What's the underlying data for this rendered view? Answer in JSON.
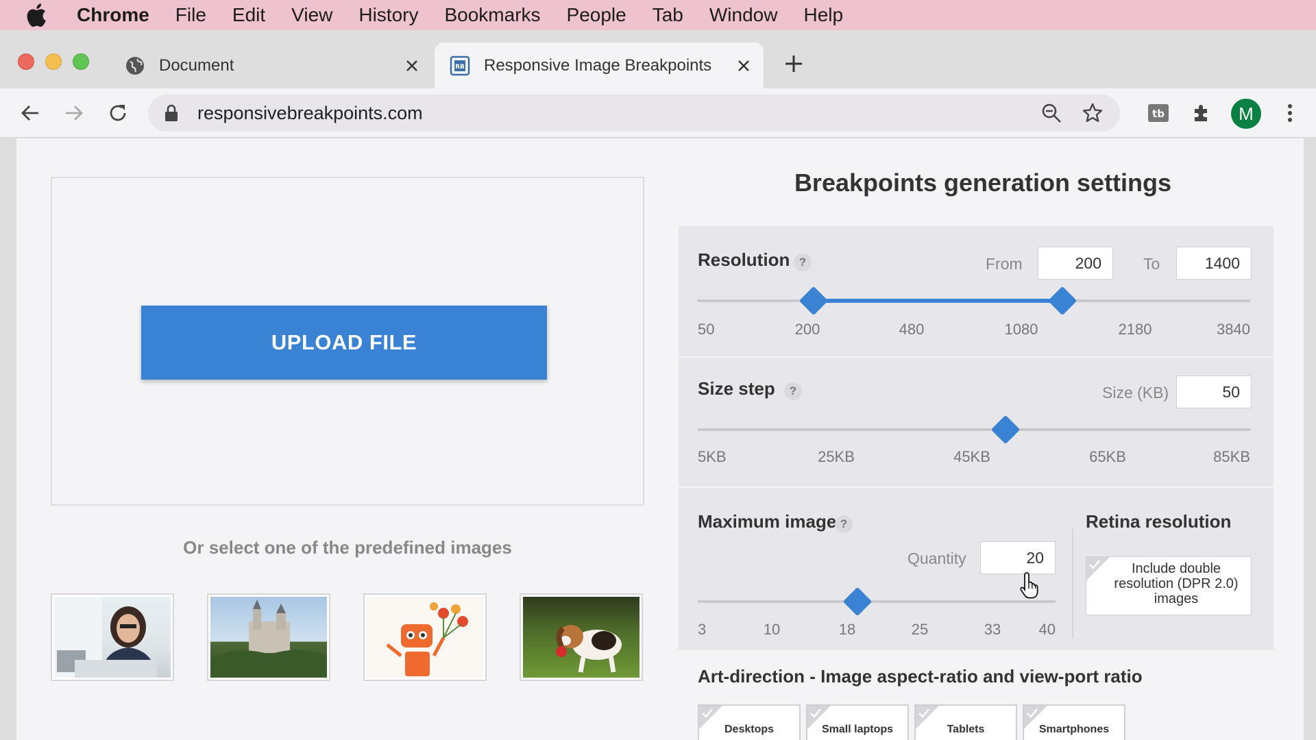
{
  "menubar": {
    "app": "Chrome",
    "items": [
      "File",
      "Edit",
      "View",
      "History",
      "Bookmarks",
      "People",
      "Tab",
      "Window",
      "Help"
    ]
  },
  "tabs": [
    {
      "title": "Document",
      "icon": "globe-icon"
    },
    {
      "title": "Responsive Image Breakpoints",
      "icon": "rb-favicon-icon"
    }
  ],
  "toolbar": {
    "url": "responsivebreakpoints.com",
    "avatar_initial": "M"
  },
  "upload": {
    "button_label": "UPLOAD FILE",
    "predefined_label": "Or select one of the predefined images"
  },
  "settings": {
    "title": "Breakpoints generation settings",
    "resolution": {
      "title": "Resolution",
      "help": "?",
      "from_label": "From",
      "from_value": "200",
      "to_label": "To",
      "to_value": "1400",
      "ticks": [
        "50",
        "200",
        "480",
        "1080",
        "2180",
        "3840"
      ]
    },
    "size_step": {
      "title": "Size step",
      "help": "?",
      "size_label": "Size (KB)",
      "size_value": "50",
      "ticks": [
        "5KB",
        "25KB",
        "45KB",
        "65KB",
        "85KB"
      ]
    },
    "max_images": {
      "title": "Maximum images",
      "help": "?",
      "quantity_label": "Quantity",
      "quantity_value": "20",
      "ticks": [
        "3",
        "10",
        "18",
        "25",
        "33",
        "40"
      ]
    },
    "retina": {
      "title": "Retina resolution",
      "option_label": "Include double resolution (DPR 2.0) images"
    }
  },
  "art_direction": {
    "title": "Art-direction - Image aspect-ratio and view-port ratio",
    "options": [
      "Desktops",
      "Small laptops",
      "Tablets",
      "Smartphones"
    ]
  },
  "colors": {
    "accent": "#3a82d4",
    "menubar": "#eec3cf"
  }
}
